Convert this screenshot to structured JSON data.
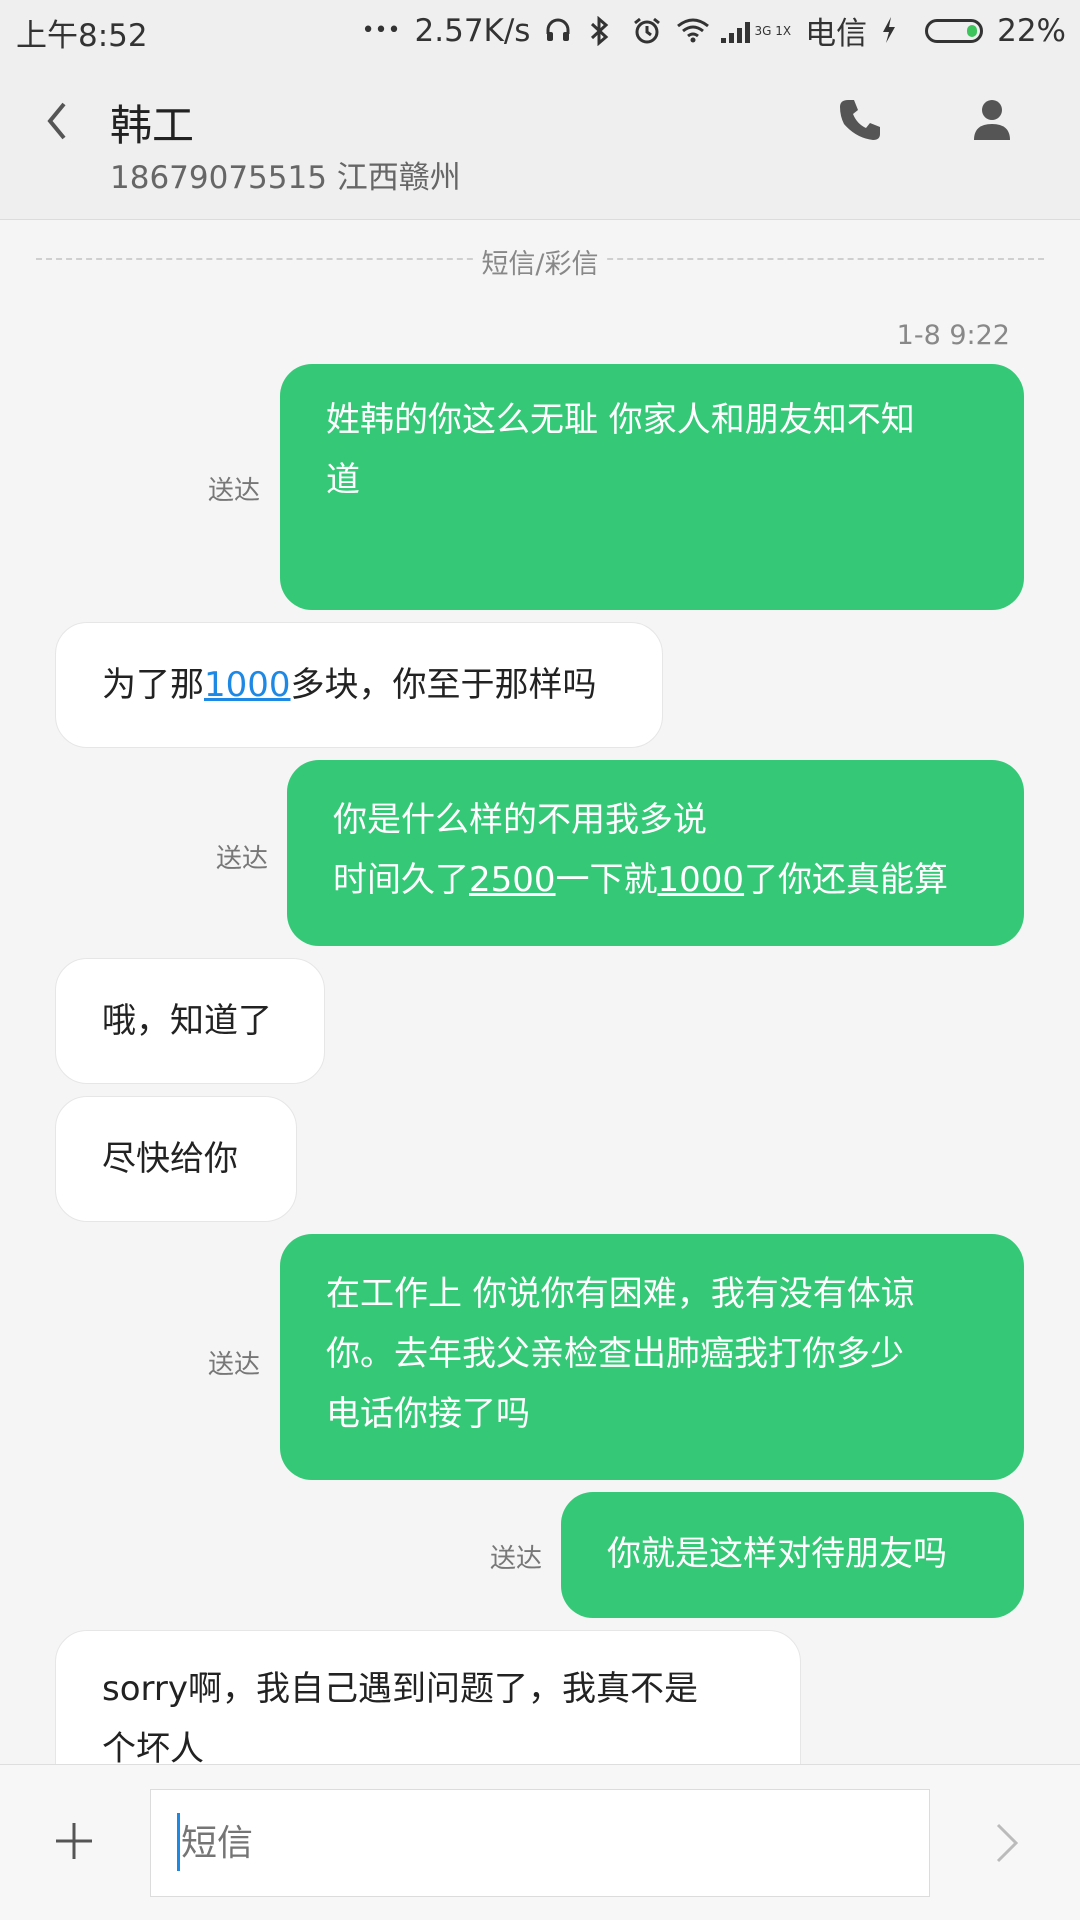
{
  "status_bar": {
    "time": "上午8:52",
    "dots": "•••",
    "speed": "2.57K/s",
    "net_top": "3G",
    "net_bottom": "1X",
    "carrier": "电信",
    "battery": "22%",
    "battery_level": 0.22
  },
  "header": {
    "name": "韩工",
    "subtitle": "18679075515 江西赣州"
  },
  "chat": {
    "divider_label": "短信/彩信",
    "timestamp": "1-8 9:22",
    "sent_status": "送达",
    "m1_line1": "姓韩的你这么无耻 你家人和朋友知不知",
    "m1_line2": "道",
    "m2_pre": "为了那",
    "m2_link": "1000",
    "m2_post": "多块，你至于那样吗",
    "m3_line1": "你是什么样的不用我多说",
    "m3_pre": "时间久了",
    "m3_link1": "2500",
    "m3_mid": "一下就",
    "m3_link2": "1000",
    "m3_post": "了你还真能算",
    "m4": "哦，知道了",
    "m5": "尽快给你",
    "m6_line1": "在工作上 你说你有困难，我有没有体谅",
    "m6_line2": "你。去年我父亲检查出肺癌我打你多少",
    "m6_line3": "电话你接了吗",
    "m7": "你就是这样对待朋友吗",
    "m8_line1": "sorry啊，我自己遇到问题了，我真不是",
    "m8_line2": "个坏人"
  },
  "input": {
    "placeholder": "短信"
  },
  "colors": {
    "outgoing_bubble": "#35c977",
    "incoming_bubble": "#ffffff",
    "link": "#1e88e5"
  }
}
